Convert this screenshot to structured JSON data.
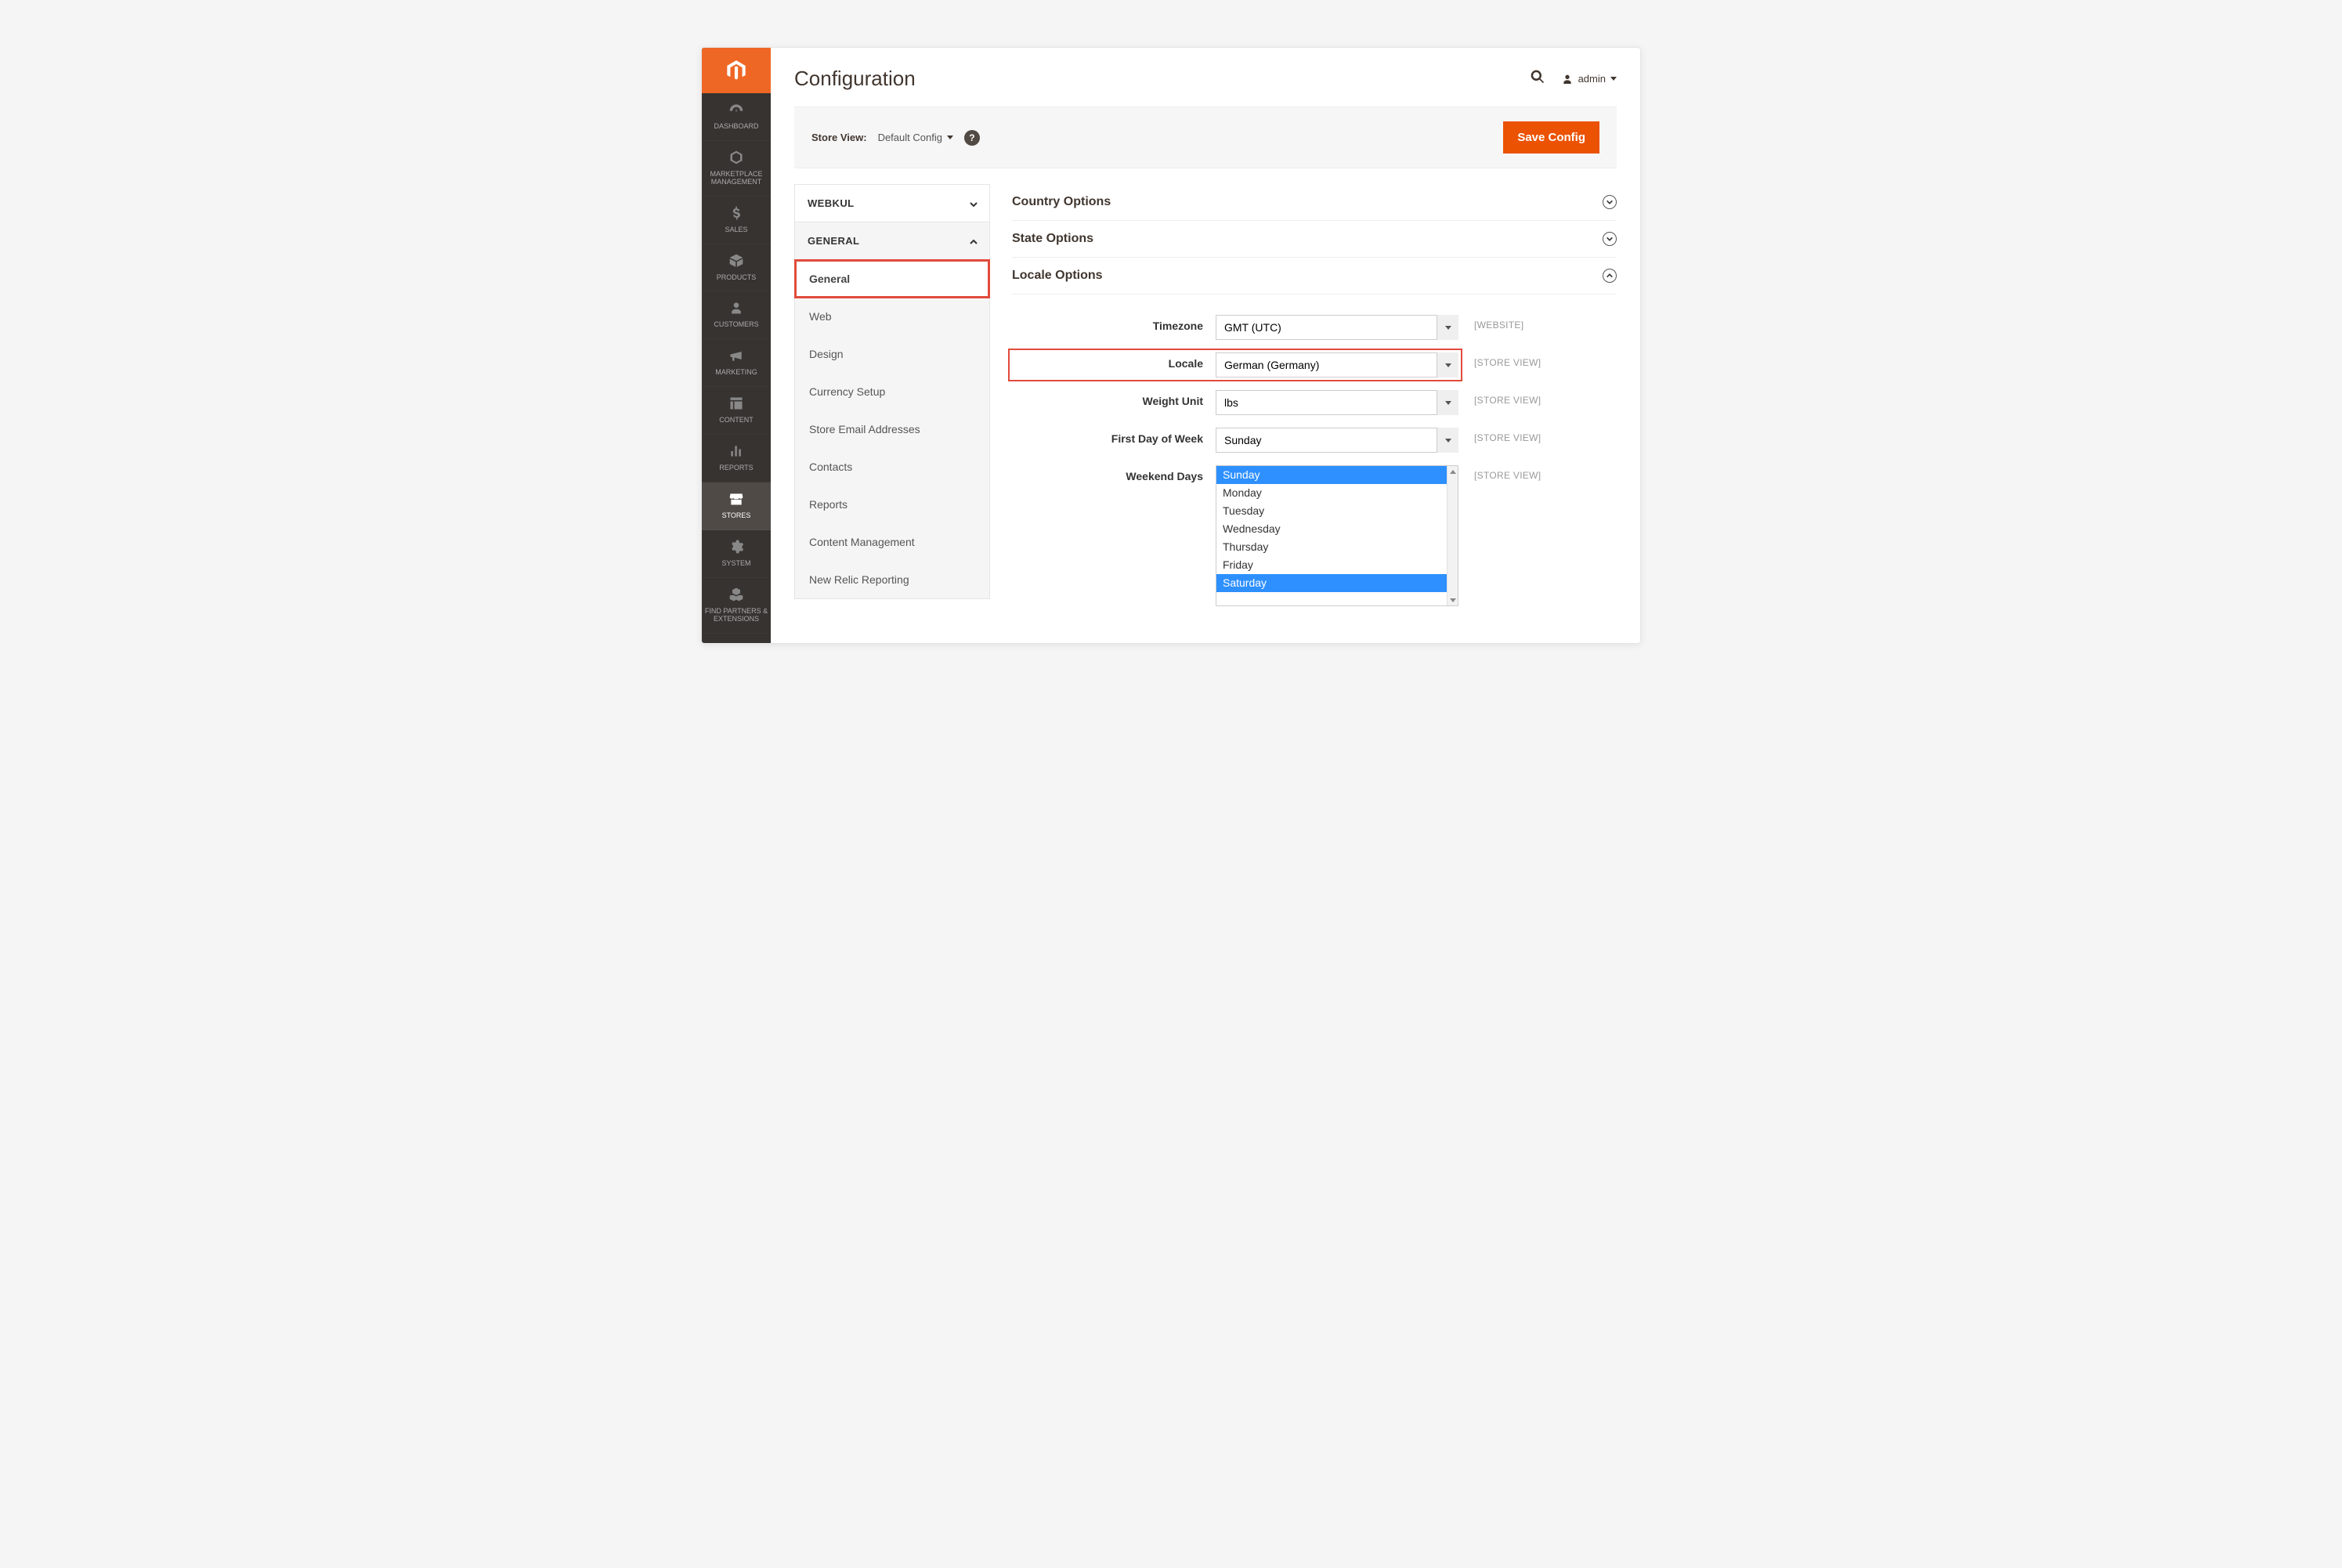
{
  "page": {
    "title": "Configuration"
  },
  "header": {
    "username": "admin"
  },
  "toolbar": {
    "scope_label": "Store View:",
    "scope_value": "Default Config",
    "save_label": "Save Config"
  },
  "rail": {
    "items": [
      {
        "name": "dashboard",
        "label": "DASHBOARD"
      },
      {
        "name": "marketplace",
        "label": "MARKETPLACE MANAGEMENT"
      },
      {
        "name": "sales",
        "label": "SALES"
      },
      {
        "name": "products",
        "label": "PRODUCTS"
      },
      {
        "name": "customers",
        "label": "CUSTOMERS"
      },
      {
        "name": "marketing",
        "label": "MARKETING"
      },
      {
        "name": "content",
        "label": "CONTENT"
      },
      {
        "name": "reports",
        "label": "REPORTS"
      },
      {
        "name": "stores",
        "label": "STORES",
        "active": true
      },
      {
        "name": "system",
        "label": "SYSTEM"
      },
      {
        "name": "partners",
        "label": "FIND PARTNERS & EXTENSIONS"
      }
    ]
  },
  "sidebar": {
    "groups": [
      {
        "title": "WEBKUL",
        "expanded": false,
        "items": []
      },
      {
        "title": "GENERAL",
        "expanded": true,
        "items": [
          {
            "label": "General",
            "active": true
          },
          {
            "label": "Web"
          },
          {
            "label": "Design"
          },
          {
            "label": "Currency Setup"
          },
          {
            "label": "Store Email Addresses"
          },
          {
            "label": "Contacts"
          },
          {
            "label": "Reports"
          },
          {
            "label": "Content Management"
          },
          {
            "label": "New Relic Reporting"
          }
        ]
      }
    ]
  },
  "sections": {
    "country": "Country Options",
    "state": "State Options",
    "locale": "Locale Options"
  },
  "locale": {
    "fields": {
      "timezone": {
        "label": "Timezone",
        "value": "GMT (UTC)",
        "scope": "[WEBSITE]"
      },
      "locale": {
        "label": "Locale",
        "value": "German (Germany)",
        "scope": "[STORE VIEW]",
        "highlight": true
      },
      "weight": {
        "label": "Weight Unit",
        "value": "lbs",
        "scope": "[STORE VIEW]"
      },
      "firstday": {
        "label": "First Day of Week",
        "value": "Sunday",
        "scope": "[STORE VIEW]"
      },
      "weekend": {
        "label": "Weekend Days",
        "scope": "[STORE VIEW]",
        "options": [
          {
            "label": "Sunday",
            "selected": true
          },
          {
            "label": "Monday"
          },
          {
            "label": "Tuesday"
          },
          {
            "label": "Wednesday"
          },
          {
            "label": "Thursday"
          },
          {
            "label": "Friday"
          },
          {
            "label": "Saturday",
            "selected": true
          }
        ]
      }
    }
  }
}
